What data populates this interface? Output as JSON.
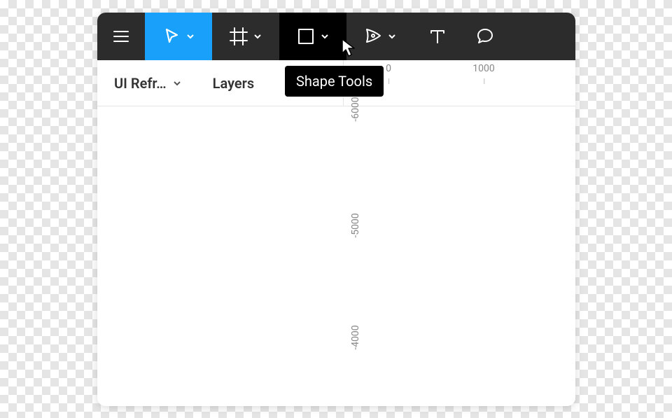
{
  "toolbar": {
    "tooltip_shape": "Shape Tools"
  },
  "panel": {
    "doc_name": "UI Refr…",
    "tab_layers": "Layers"
  },
  "ruler": {
    "h": {
      "t0": "0",
      "t1": "1000"
    },
    "v": {
      "t0": "-6000",
      "t1": "-5000",
      "t2": "-4000"
    }
  }
}
